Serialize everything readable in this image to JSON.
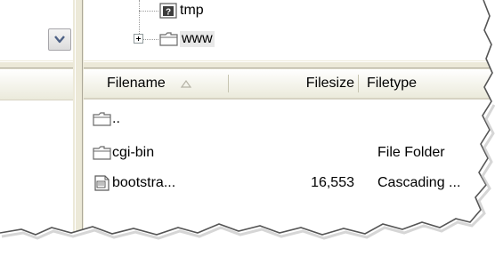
{
  "tree": {
    "nodes": [
      {
        "label": "tmp",
        "icon": "help-file-icon"
      },
      {
        "label": "www",
        "icon": "folder-icon",
        "expandable": true
      }
    ]
  },
  "list": {
    "columns": [
      {
        "label": "Filename",
        "sort": "ascending"
      },
      {
        "label": "Filesize"
      },
      {
        "label": "Filetype"
      }
    ],
    "rows": [
      {
        "name": "..",
        "size": "",
        "type": "",
        "icon": "folder-icon"
      },
      {
        "name": "cgi-bin",
        "size": "",
        "type": "File Folder",
        "icon": "folder-icon"
      },
      {
        "name": "bootstra...",
        "size": "16,553",
        "type": "Cascading ...",
        "icon": "document-icon"
      }
    ]
  },
  "colors": {
    "chrome": "#ece9d8",
    "header_border": "#d6d2c2",
    "selection": "#e8e8e8"
  }
}
